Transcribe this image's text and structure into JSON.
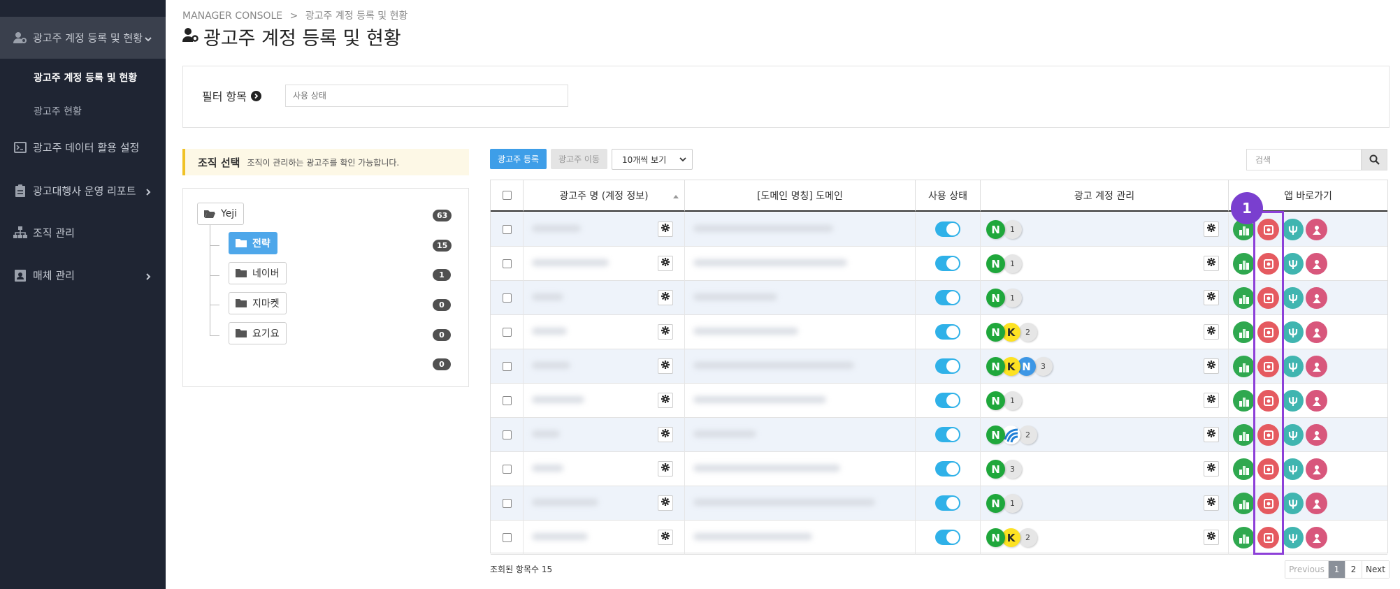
{
  "sidebar": {
    "menus": [
      {
        "label": "광고주 계정 등록 및 현황",
        "icon": "user-gear-icon",
        "active": true,
        "chevron": "down"
      },
      {
        "label": "광고주 데이터 활용 설정",
        "icon": "terminal-icon",
        "active": false,
        "chevron": ""
      },
      {
        "label": "광고대행사 운영 리포트",
        "icon": "clipboard-icon",
        "active": false,
        "chevron": "right"
      },
      {
        "label": "조직 관리",
        "icon": "sitemap-icon",
        "active": false,
        "chevron": ""
      },
      {
        "label": "매체 관리",
        "icon": "id-card-icon",
        "active": false,
        "chevron": "right"
      }
    ],
    "sub_items": [
      {
        "label": "광고주 계정 등록 및 현황",
        "active": true
      },
      {
        "label": "광고주 현황",
        "active": false
      }
    ]
  },
  "breadcrumb": {
    "root": "MANAGER CONSOLE",
    "sep": ">",
    "current": "광고주 계정 등록 및 현황"
  },
  "page_title": "광고주 계정 등록 및 현황",
  "filter": {
    "label": "필터 항목",
    "placeholder": "사용 상태"
  },
  "org": {
    "title": "조직 선택",
    "desc": "조직이 관리하는 광고주를 확인 가능합니다.",
    "root": {
      "name": "Yeji",
      "count": "63"
    },
    "children": [
      {
        "name": "전략",
        "count": "15",
        "selected": true
      },
      {
        "name": "네이버",
        "count": "1",
        "selected": false
      },
      {
        "name": "지마켓",
        "count": "0",
        "selected": false
      },
      {
        "name": "요기요",
        "count": "0",
        "selected": false
      }
    ],
    "extra_count": "0"
  },
  "toolbar": {
    "register_label": "광고주 등록",
    "move_label": "광고주 이동",
    "view_select": "10개씩 보기",
    "search_placeholder": "검색"
  },
  "table": {
    "columns": [
      "광고주 명 (계정 정보)",
      "[도메인 명칭] 도메인",
      "사용 상태",
      "광고 계정 관리",
      "앱 바로가기"
    ],
    "rows": [
      {
        "media": [
          "N"
        ],
        "count": "1"
      },
      {
        "media": [
          "N"
        ],
        "count": "1"
      },
      {
        "media": [
          "N"
        ],
        "count": "1"
      },
      {
        "media": [
          "N",
          "K"
        ],
        "count": "2"
      },
      {
        "media": [
          "N",
          "K",
          "NB"
        ],
        "count": "3"
      },
      {
        "media": [
          "N"
        ],
        "count": "1"
      },
      {
        "media": [
          "N",
          "W"
        ],
        "count": "2"
      },
      {
        "media": [
          "N"
        ],
        "count": "3"
      },
      {
        "media": [
          "N"
        ],
        "count": "1"
      },
      {
        "media": [
          "N",
          "K"
        ],
        "count": "2"
      }
    ]
  },
  "annotation": {
    "badge": "1"
  },
  "footer": {
    "count_text": "조회된 항목수 15"
  },
  "pagination": {
    "prev": "Previous",
    "pages": [
      "1",
      "2"
    ],
    "current": "1",
    "next": "Next"
  },
  "colors": {
    "sidebar_bg": "#1f2533",
    "accent": "#3e9ee8",
    "toggle_on": "#2fb1e8",
    "naver_green": "#1fa73b",
    "kakao_yellow": "#fde223",
    "highlight": "#8d40d8"
  }
}
